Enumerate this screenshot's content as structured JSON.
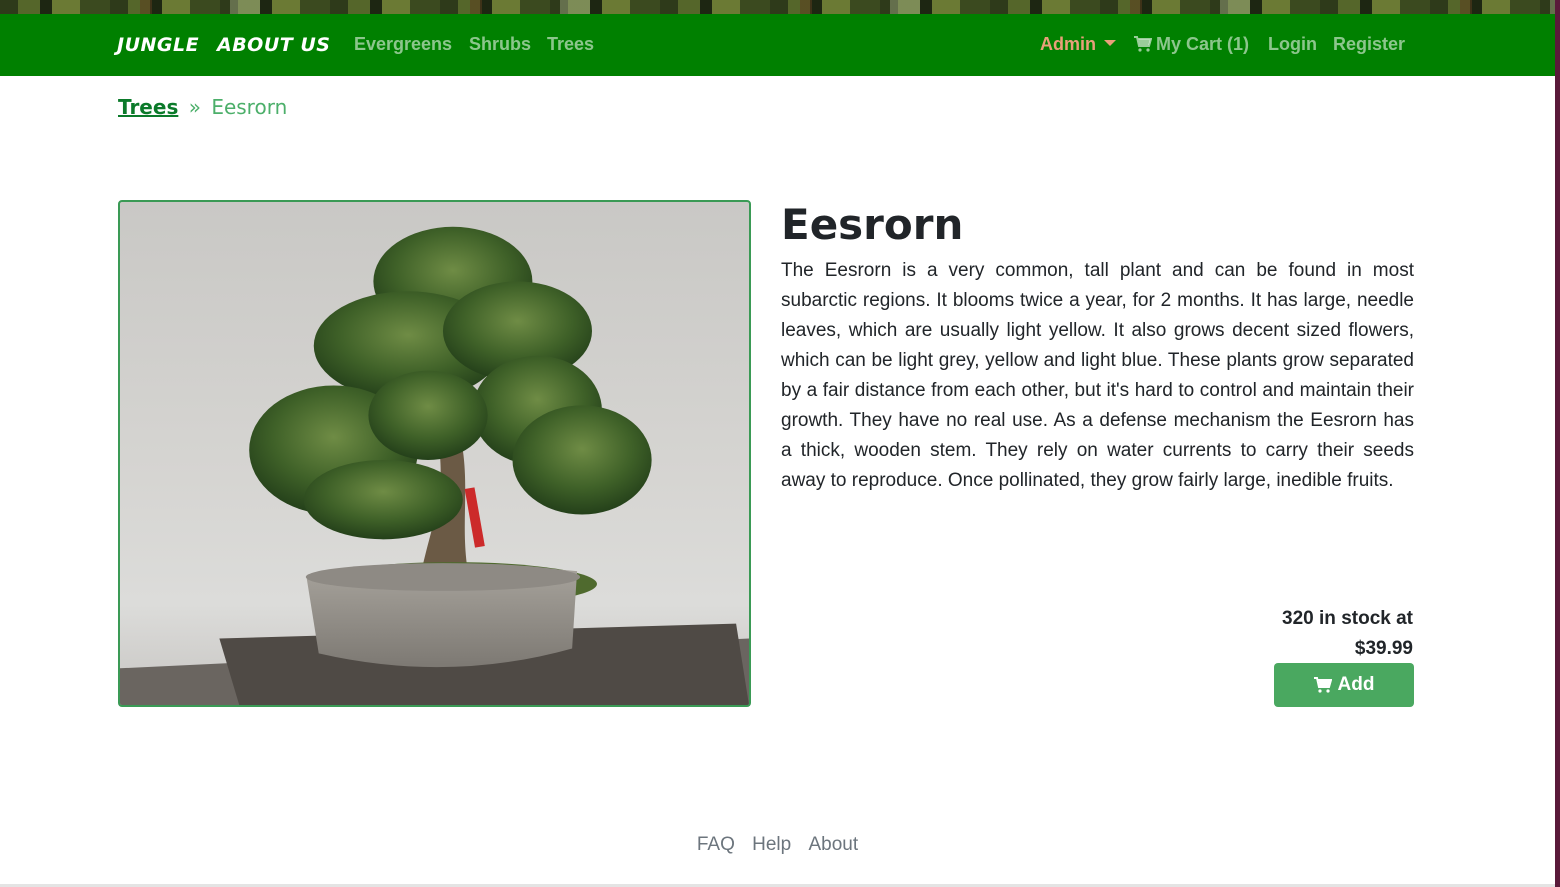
{
  "navbar": {
    "brand": "JUNGLE",
    "about": "ABOUT US",
    "links": [
      "Evergreens",
      "Shrubs",
      "Trees"
    ],
    "admin": "Admin",
    "cart": "My Cart (1)",
    "login": "Login",
    "register": "Register",
    "bg_color": "#008000"
  },
  "breadcrumb": {
    "parent": "Trees",
    "separator": "»",
    "current": "Eesrorn"
  },
  "product": {
    "name": "Eesrorn",
    "description": "The Eesrorn is a very common, tall plant and can be found in most subarctic regions. It blooms twice a year, for 2 months. It has large, needle leaves, which are usually light yellow. It also grows decent sized flowers, which can be light grey, yellow and light blue. These plants grow separated by a fair distance from each other, but it's hard to control and maintain their growth. They have no real use. As a defense mechanism the Eesrorn has a thick, wooden stem. They rely on water currents to carry their seeds away to reproduce. Once pollinated, they grow fairly large, inedible fruits.",
    "stock_line": "320 in stock at",
    "price": "$39.99",
    "add_label": "Add",
    "image_icon": "bonsai-tree-photo",
    "accent_color": "#4aa860"
  },
  "footer": {
    "links": [
      "FAQ",
      "Help",
      "About"
    ]
  }
}
